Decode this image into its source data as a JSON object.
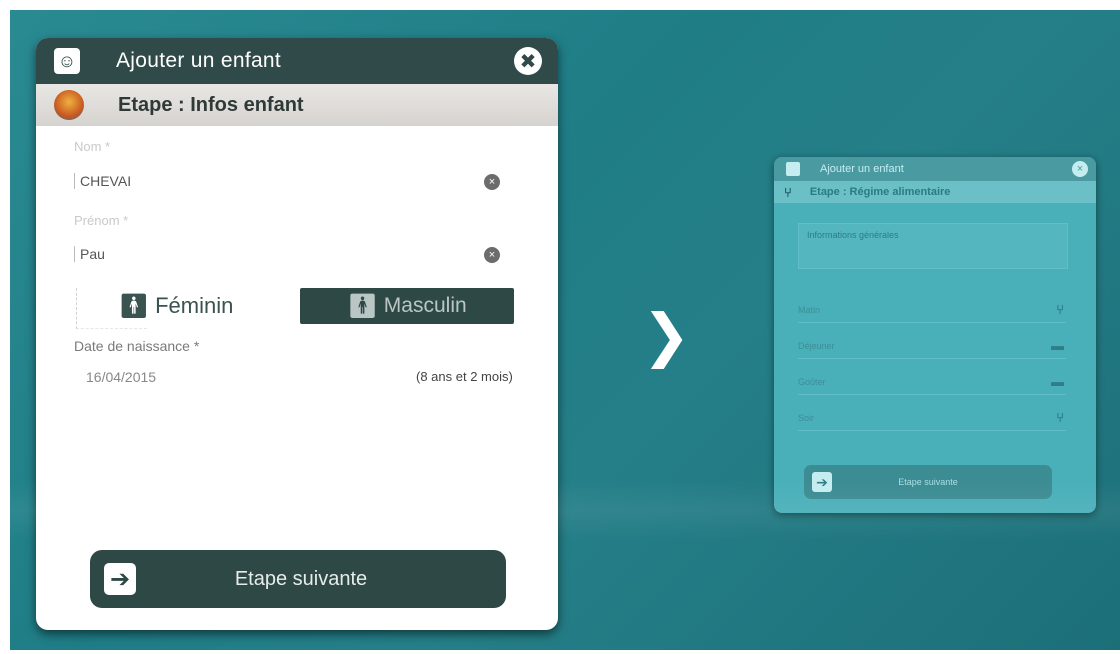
{
  "dialog": {
    "title": "Ajouter un enfant",
    "close_glyph": "✖",
    "header_icon": "add-user-icon",
    "step_title": "Etape : Infos enfant"
  },
  "form": {
    "nom": {
      "label": "Nom *",
      "value": "CHEVAI"
    },
    "prenom": {
      "label": "Prénom *",
      "value": "Pau"
    },
    "gender": {
      "feminin": "Féminin",
      "masculin": "Masculin",
      "selected": "Masculin"
    },
    "dob": {
      "label": "Date de naissance *",
      "value": "16/04/2015",
      "age": "(8 ans et 2 mois)"
    }
  },
  "next_button": {
    "label": "Etape suivante",
    "icon": "arrow-right-icon"
  },
  "preview": {
    "title": "Ajouter un enfant",
    "step_title": "Etape : Régime alimentaire",
    "box_text": "Informations générales",
    "rows": [
      "Matin",
      "Déjeuner",
      "Goûter",
      "Soir"
    ],
    "next_label": "Etape suivante"
  },
  "colors": {
    "header_bg": "#2f4a48",
    "button_bg": "#2e4846",
    "background_teal": "#1f7d86"
  }
}
